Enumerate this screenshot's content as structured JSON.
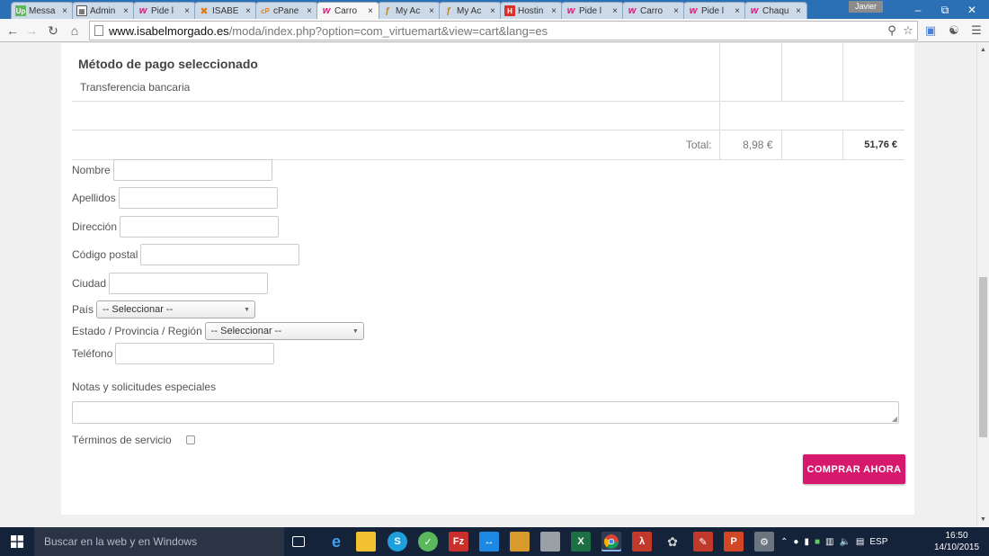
{
  "browser": {
    "tabs": [
      {
        "favicon": "up",
        "title": "Messa"
      },
      {
        "favicon": "adm",
        "title": "Admin"
      },
      {
        "favicon": "w",
        "title": "Pide l"
      },
      {
        "favicon": "j",
        "title": "ISABE"
      },
      {
        "favicon": "cp",
        "title": "cPane"
      },
      {
        "favicon": "w",
        "title": "Carro",
        "active": true
      },
      {
        "favicon": "my",
        "title": "My Ac"
      },
      {
        "favicon": "my",
        "title": "My Ac"
      },
      {
        "favicon": "h",
        "title": "Hostin"
      },
      {
        "favicon": "w",
        "title": "Pide l"
      },
      {
        "favicon": "w",
        "title": "Carro"
      },
      {
        "favicon": "w",
        "title": "Pide l"
      },
      {
        "favicon": "w",
        "title": "Chaqu"
      }
    ],
    "user_name": "Javier",
    "url_host": "www.isabelmorgado.es",
    "url_path": "/moda/index.php?option=com_virtuemart&view=cart&lang=es"
  },
  "cart": {
    "payment_title": "Método de pago seleccionado",
    "payment_value": "Transferencia bancaria",
    "total_label": "Total:",
    "total_tax": "8,98 €",
    "total_amount": "51,76 €"
  },
  "form": {
    "nombre_label": "Nombre",
    "apellidos_label": "Apellidos",
    "direccion_label": "Dirección",
    "codigo_postal_label": "Código postal",
    "ciudad_label": "Ciudad",
    "pais_label": "País",
    "pais_selected": "-- Seleccionar --",
    "estado_label": "Estado / Provincia / Región",
    "estado_selected": "-- Seleccionar --",
    "telefono_label": "Teléfono",
    "notes_label": "Notas y solicitudes especiales",
    "terms_label": "Términos de servicio",
    "buy_label": "COMPRAR AHORA"
  },
  "taskbar": {
    "search_placeholder": "Buscar en la web y en Windows",
    "language": "ESP",
    "time": "16:50",
    "date": "14/10/2015"
  },
  "colors": {
    "accent": "#d6196d",
    "titlebar": "#2b6fb5",
    "taskbar": "#14223a"
  }
}
